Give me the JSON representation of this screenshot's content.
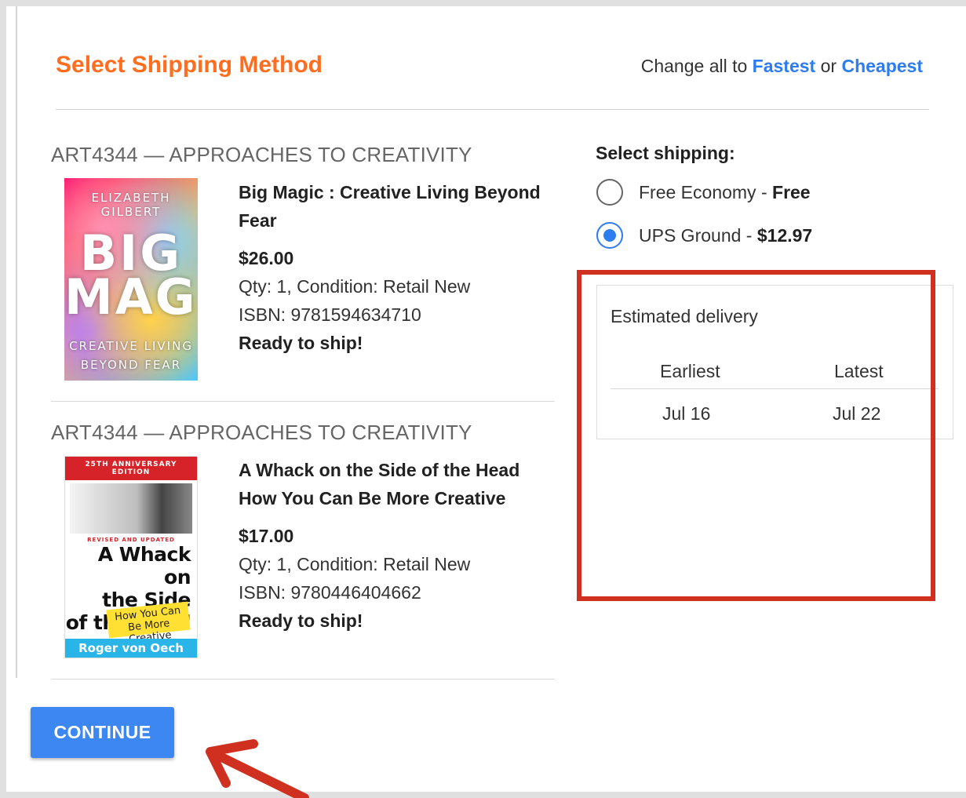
{
  "header": {
    "title": "Select Shipping Method",
    "change_all_prefix": "Change all to",
    "fastest_label": "Fastest",
    "or_label": "or",
    "cheapest_label": "Cheapest"
  },
  "items": [
    {
      "course": "ART4344 — APPROACHES TO CREATIVITY",
      "title": "Big Magic : Creative Living Beyond Fear",
      "price": "$26.00",
      "qty_condition": "Qty: 1, Condition: Retail New",
      "isbn": "ISBN: 9781594634710",
      "status": "Ready to ship!",
      "cover": {
        "author": "ELIZABETH GILBERT",
        "title_line1": "BIG",
        "title_line2": "MAGIC",
        "subtitle_line1": "CREATIVE LIVING",
        "subtitle_line2": "BEYOND FEAR"
      }
    },
    {
      "course": "ART4344 — APPROACHES TO CREATIVITY",
      "title": "A Whack on the Side of the Head How You Can Be More Creative",
      "price": "$17.00",
      "qty_condition": "Qty: 1, Condition: Retail New",
      "isbn": "ISBN: 9780446404662",
      "status": "Ready to ship!",
      "cover": {
        "band": "25TH ANNIVERSARY EDITION",
        "revised": "REVISED AND UPDATED",
        "title_line1": "A Whack on",
        "title_line2": "the Side",
        "title_line3": "of the Head",
        "sticker": "How You Can Be More Creative",
        "author": "Roger von Oech"
      }
    }
  ],
  "shipping": {
    "label": "Select shipping:",
    "options": [
      {
        "name": "Free Economy",
        "separator": " - ",
        "price": "Free",
        "selected": false
      },
      {
        "name": "UPS Ground",
        "separator": " - ",
        "price": "$12.97",
        "selected": true
      }
    ]
  },
  "delivery": {
    "title": "Estimated delivery",
    "earliest_label": "Earliest",
    "latest_label": "Latest",
    "earliest_value": "Jul 16",
    "latest_value": "Jul 22"
  },
  "actions": {
    "continue_label": "CONTINUE"
  },
  "colors": {
    "title": "#ff6d1f",
    "link": "#2d7cf0",
    "primary_button": "#3c87f1",
    "annotation": "#d0301f"
  }
}
